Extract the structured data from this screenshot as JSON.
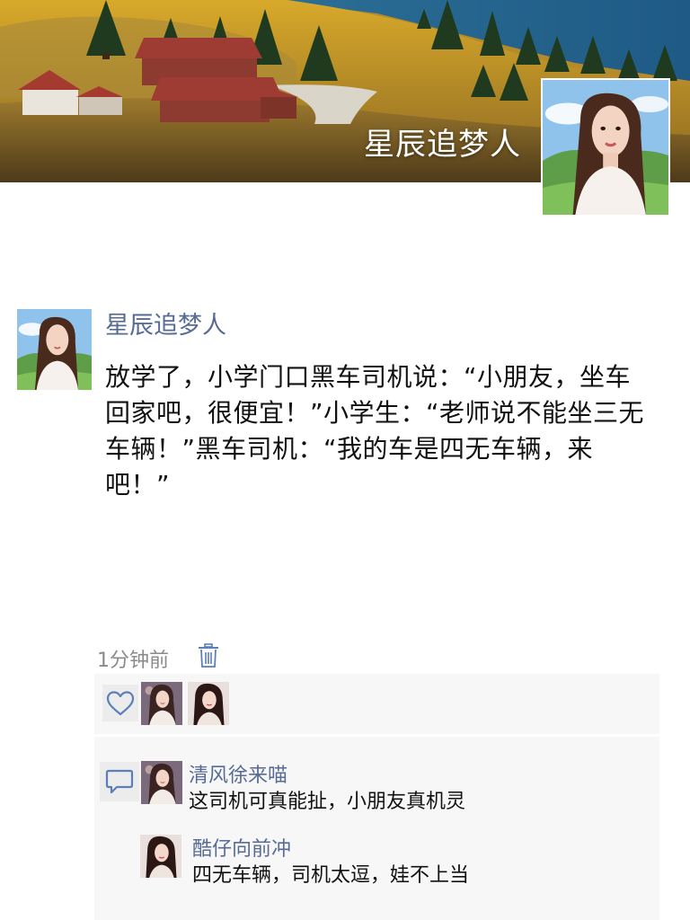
{
  "profile": {
    "name": "星辰追梦人"
  },
  "post": {
    "author": "星辰追梦人",
    "text": "放学了，小学门口黑车司机说：“小朋友，坐车回家吧，很便宜！”小学生：“老师说不能坐三无车辆！”黑车司机：“我的车是四无车辆，来吧！”",
    "time": "1分钟前"
  },
  "likes": {
    "icon": "heart-outline-icon",
    "count": 2
  },
  "comments": [
    {
      "author": "清风徐来喵",
      "text": "这司机可真能扯，小朋友真机灵"
    },
    {
      "author": "酷仔向前冲",
      "text": "四无车辆，司机太逗，娃不上当"
    }
  ],
  "colors": {
    "link": "#576b95",
    "background": "#ffffff",
    "panel": "#f7f7f7",
    "text": "#111111",
    "muted": "#8a8a8a",
    "icon": "#5b7fb8"
  }
}
